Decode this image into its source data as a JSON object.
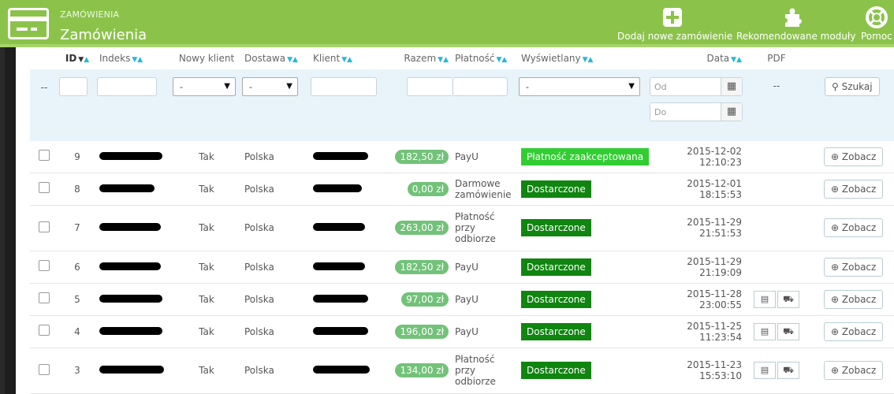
{
  "header": {
    "breadcrumb": "ZAMÓWIENIA",
    "title": "Zamówienia",
    "actions": [
      {
        "label": "Dodaj nowe zamówienie",
        "icon": "plus-icon"
      },
      {
        "label": "Rekomendowane moduły",
        "icon": "puzzle-icon"
      },
      {
        "label": "Pomoc",
        "icon": "lifebuoy-icon"
      }
    ]
  },
  "table": {
    "columns": [
      "ID",
      "Indeks",
      "Nowy klient",
      "Dostawa",
      "Klient",
      "Razem",
      "Płatność",
      "Wyświetlany",
      "Data",
      "PDF"
    ],
    "filters": {
      "reset_label": "--",
      "select_placeholder": "-",
      "date_from": "Od",
      "date_to": "Do",
      "pdf_placeholder": "--",
      "search_label": "Szukaj"
    },
    "view_label": "Zobacz",
    "rows": [
      {
        "id": "9",
        "new_client": "Tak",
        "country": "Polska",
        "total": "182,50 zł",
        "payment": "PayU",
        "status": "Płatność zaakceptowana",
        "status_color": "#32cd32",
        "date": "2015-12-02",
        "time": "12:10:23",
        "pdf": false
      },
      {
        "id": "8",
        "new_client": "Tak",
        "country": "Polska",
        "total": "0,00 zł",
        "payment": "Darmowe zamówienie",
        "status": "Dostarczone",
        "status_color": "#108510",
        "date": "2015-12-01",
        "time": "18:15:53",
        "pdf": false
      },
      {
        "id": "7",
        "new_client": "Tak",
        "country": "Polska",
        "total": "263,00 zł",
        "payment": "Płatność przy odbiorze",
        "status": "Dostarczone",
        "status_color": "#108510",
        "date": "2015-11-29",
        "time": "21:51:53",
        "pdf": false
      },
      {
        "id": "6",
        "new_client": "Tak",
        "country": "Polska",
        "total": "182,50 zł",
        "payment": "PayU",
        "status": "Dostarczone",
        "status_color": "#108510",
        "date": "2015-11-29",
        "time": "21:19:09",
        "pdf": false
      },
      {
        "id": "5",
        "new_client": "Tak",
        "country": "Polska",
        "total": "97,00 zł",
        "payment": "PayU",
        "status": "Dostarczone",
        "status_color": "#108510",
        "date": "2015-11-28",
        "time": "23:00:55",
        "pdf": true
      },
      {
        "id": "4",
        "new_client": "Tak",
        "country": "Polska",
        "total": "196,00 zł",
        "payment": "PayU",
        "status": "Dostarczone",
        "status_color": "#108510",
        "date": "2015-11-25",
        "time": "11:23:54",
        "pdf": true
      },
      {
        "id": "3",
        "new_client": "Tak",
        "country": "Polska",
        "total": "134,00 zł",
        "payment": "Płatność przy odbiorze",
        "status": "Dostarczone",
        "status_color": "#108510",
        "date": "2015-11-23",
        "time": "15:53:10",
        "pdf": true
      }
    ]
  },
  "colors": {
    "topbar": "#8bc34a",
    "price_badge": "#72c279",
    "filter_row": "#e8f4fa"
  }
}
